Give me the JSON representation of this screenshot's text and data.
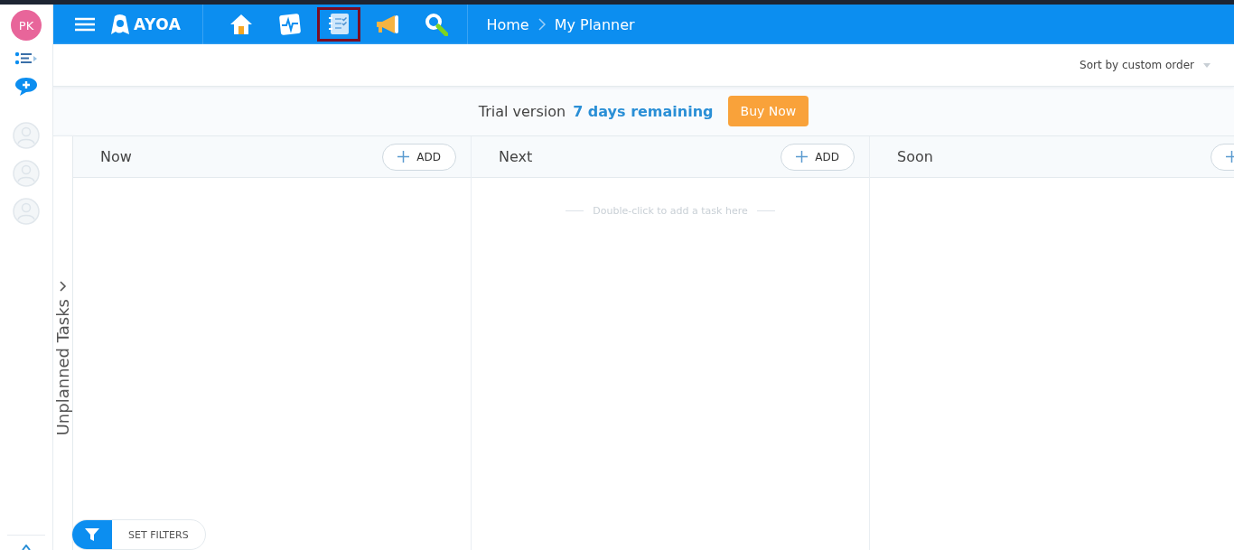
{
  "user": {
    "initials": "PK"
  },
  "nav": {
    "logo": "AYOA",
    "icons": [
      {
        "kind": "home",
        "selected": false
      },
      {
        "kind": "activity",
        "selected": false
      },
      {
        "kind": "planner",
        "selected": true
      },
      {
        "kind": "megaphone",
        "selected": false
      },
      {
        "kind": "search",
        "selected": false
      }
    ]
  },
  "breadcrumb": [
    "Home",
    "My Planner"
  ],
  "sort": {
    "label": "Sort by custom order"
  },
  "trial": {
    "text": "Trial version",
    "highlight": "7 days remaining",
    "button": "Buy Now"
  },
  "unplanned": {
    "label": "Unplanned Tasks"
  },
  "columns": [
    {
      "title": "Now",
      "add_label": "ADD"
    },
    {
      "title": "Next",
      "add_label": "ADD",
      "hint": "Double-click to add a task here"
    },
    {
      "title": "Soon"
    }
  ],
  "filters": {
    "button": "SET FILTERS"
  }
}
